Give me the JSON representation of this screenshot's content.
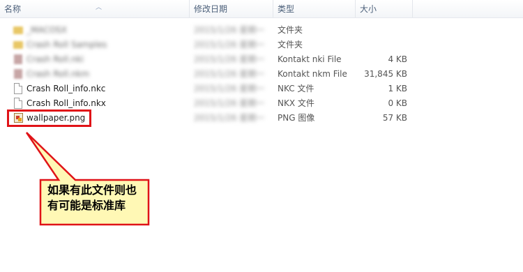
{
  "header": {
    "columns": [
      "名称",
      "修改日期",
      "类型",
      "大小"
    ]
  },
  "files": [
    {
      "icon": "folder-icon",
      "name": "_MACOSX",
      "date": "2015/1/26 星期一",
      "type": "文件夹",
      "size": ""
    },
    {
      "icon": "folder-icon",
      "name": "Crash Roll Samples",
      "date": "2015/1/26 星期一",
      "type": "文件夹",
      "size": ""
    },
    {
      "icon": "kontakt-icon",
      "name": "Crash Roll.nki",
      "date": "2015/1/26 星期一",
      "type": "Kontakt nki File",
      "size": "4 KB"
    },
    {
      "icon": "kontakt-icon",
      "name": "Crash Roll.nkm",
      "date": "2015/1/26 星期一",
      "type": "Kontakt nkm File",
      "size": "31,845 KB"
    },
    {
      "icon": "file-icon",
      "name": "Crash Roll_info.nkc",
      "date": "2015/1/26 星期一",
      "type": "NKC 文件",
      "size": "1 KB"
    },
    {
      "icon": "file-icon",
      "name": "Crash Roll_info.nkx",
      "date": "2015/1/26 星期一",
      "type": "NKX 文件",
      "size": "0 KB"
    },
    {
      "icon": "png-image-icon",
      "name": "wallpaper.png",
      "date": "2015/1/26 星期一",
      "type": "PNG 图像",
      "size": "57 KB"
    }
  ],
  "callout": {
    "line1": "如果有此文件则也",
    "line2": "有可能是标准库"
  },
  "colors": {
    "highlight": "#e01318",
    "callout_fill": "#fff8b5",
    "folder": "#e8c766"
  }
}
